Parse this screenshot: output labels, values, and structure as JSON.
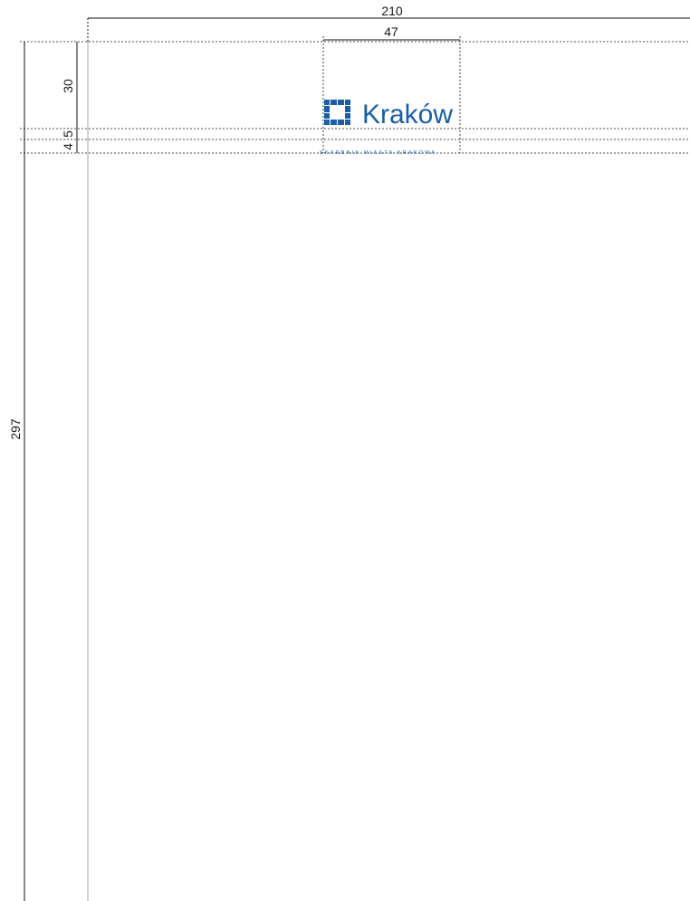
{
  "dimensions": {
    "sheet_width": "210",
    "logo_width": "47",
    "top_margin": "30",
    "logo_height": "5",
    "gap": "4",
    "sheet_height": "297"
  },
  "logo": {
    "wordmark": "Kraków",
    "tagline": "SKARBNIK MIASTA KRAKOWA",
    "color": "#1a5ea8"
  }
}
